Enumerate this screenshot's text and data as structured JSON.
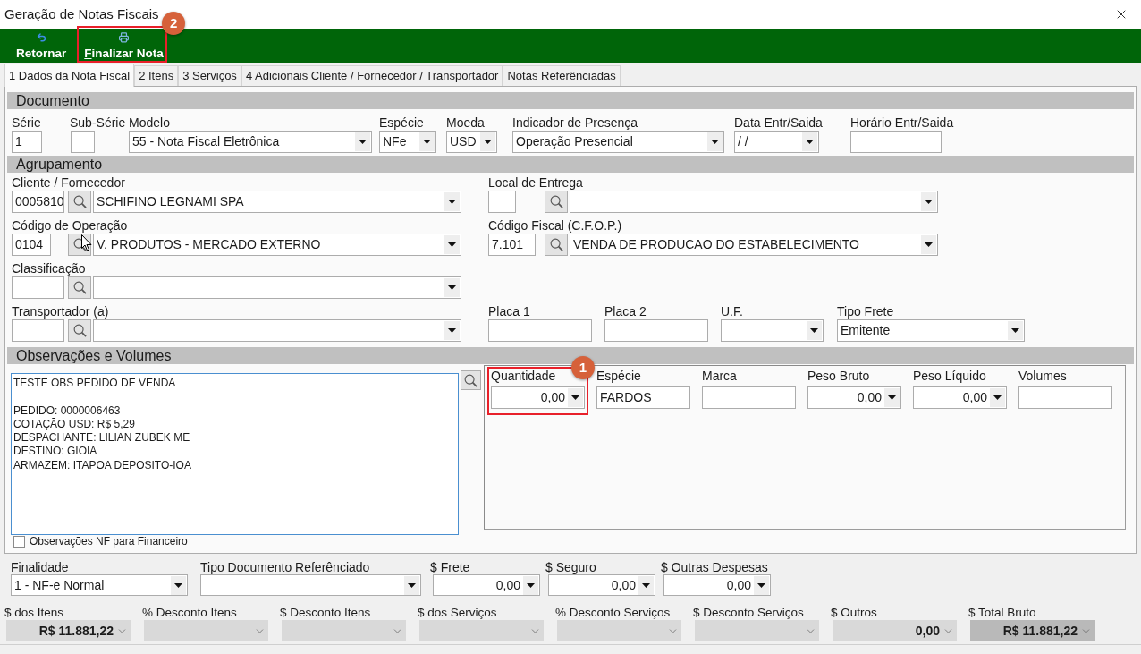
{
  "window": {
    "title": "Geração de Notas Fiscais"
  },
  "toolbar": [
    {
      "kind": "undo",
      "label": "Retornar",
      "mnemonic": false
    },
    {
      "kind": "print",
      "label": "Finalizar Nota",
      "mnemonic": true,
      "callout": "2"
    }
  ],
  "tabs": [
    {
      "label": "1 Dados da Nota Fiscal",
      "mnemonic": true,
      "selected": true
    },
    {
      "label": "2 Itens",
      "mnemonic": true,
      "selected": false
    },
    {
      "label": "3 Serviços",
      "mnemonic": true,
      "selected": false
    },
    {
      "label": "4 Adicionais Cliente / Fornecedor / Transportador",
      "mnemonic": true,
      "selected": false
    },
    {
      "label": "Notas Referênciadas",
      "mnemonic": false,
      "selected": false
    }
  ],
  "documento": {
    "title": "Documento",
    "fields": [
      {
        "kind": "text",
        "label": "Série",
        "value": "1"
      },
      {
        "kind": "text",
        "label": "Sub-Série"
      },
      {
        "kind": "select",
        "label": "Modelo",
        "value": "55 - Nota Fiscal Eletrônica"
      },
      {
        "kind": "select",
        "label": "Espécie",
        "value": "NFe"
      },
      {
        "kind": "select",
        "label": "Moeda",
        "value": "USD"
      },
      {
        "kind": "select",
        "label": "Indicador de Presença",
        "value": "Operação Presencial"
      },
      {
        "kind": "select",
        "label": "Data Entr/Saida",
        "value": "/ /"
      },
      {
        "kind": "text",
        "label": "Horário Entr/Saida"
      }
    ]
  },
  "agrupamento": {
    "title": "Agrupamento",
    "rows": [
      {
        "left": {
          "kind": "lookup",
          "label": "Cliente / Fornecedor",
          "code": "0005810",
          "value": "SCHIFINO LEGNAMI SPA"
        },
        "right": [
          {
            "kind": "lookup",
            "label": "Local de Entrega"
          }
        ]
      },
      {
        "left": {
          "kind": "lookup",
          "label": "Código de Operação",
          "code": "0104",
          "value": "V. PRODUTOS - MERCADO EXTERNO"
        },
        "right": [
          {
            "kind": "lookup",
            "label": "Código Fiscal (C.F.O.P.)",
            "code": "7.101",
            "value": "VENDA DE PRODUCAO DO ESTABELECIMENTO"
          }
        ]
      },
      {
        "left": {
          "kind": "lookup",
          "label": "Classificação"
        }
      },
      {
        "left": {
          "kind": "lookup",
          "label": "Transportador (a)"
        },
        "right": [
          {
            "kind": "text",
            "label": "Placa 1"
          },
          {
            "kind": "text",
            "label": "Placa 2"
          },
          {
            "kind": "select",
            "label": "U.F."
          },
          {
            "kind": "select",
            "label": "Tipo Frete",
            "value": "Emitente"
          }
        ]
      }
    ]
  },
  "observacoes": {
    "title": "Observações e Volumes",
    "notes": "TESTE OBS PEDIDO DE VENDA\n\nPEDIDO: 0000006463\nCOTAÇÃO USD: R$ 5,29\nDESPACHANTE: LILIAN ZUBEK ME\nDESTINO: GIOIA\nARMAZEM: ITAPOA DEPOSITO-IOA",
    "checkbox": {
      "label": "Observações NF para Financeiro",
      "checked": false
    },
    "volumes": [
      {
        "kind": "number",
        "label": "Quantidade",
        "value": "0,00",
        "callout": "1"
      },
      {
        "kind": "text",
        "label": "Espécie",
        "value": "FARDOS"
      },
      {
        "kind": "text",
        "label": "Marca"
      },
      {
        "kind": "number",
        "label": "Peso Bruto",
        "value": "0,00"
      },
      {
        "kind": "number",
        "label": "Peso Líquido",
        "value": "0,00"
      },
      {
        "kind": "text",
        "label": "Volumes"
      }
    ]
  },
  "geral": [
    {
      "kind": "select",
      "label": "Finalidade",
      "value": "1 - NF-e Normal"
    },
    {
      "kind": "select",
      "label": "Tipo Documento Referênciado"
    },
    {
      "kind": "number",
      "label": "$ Frete",
      "value": "0,00"
    },
    {
      "kind": "number",
      "label": "$ Seguro",
      "value": "0,00"
    },
    {
      "kind": "number",
      "label": "$ Outras Despesas",
      "value": "0,00"
    }
  ],
  "totais": [
    {
      "label": "$ dos Itens",
      "value": "R$ 11.881,22",
      "emphasis": false
    },
    {
      "label": "% Desconto Itens",
      "emphasis": false
    },
    {
      "label": "$ Desconto Itens",
      "emphasis": false
    },
    {
      "label": "$ dos Serviços",
      "emphasis": false
    },
    {
      "label": "% Desconto Serviços",
      "emphasis": false
    },
    {
      "label": "$ Desconto Serviços",
      "emphasis": false
    },
    {
      "label": "$ Outros",
      "value": "0,00",
      "emphasis": false
    },
    {
      "label": "$ Total Bruto",
      "value": "R$ 11.881,22",
      "emphasis": true
    }
  ]
}
